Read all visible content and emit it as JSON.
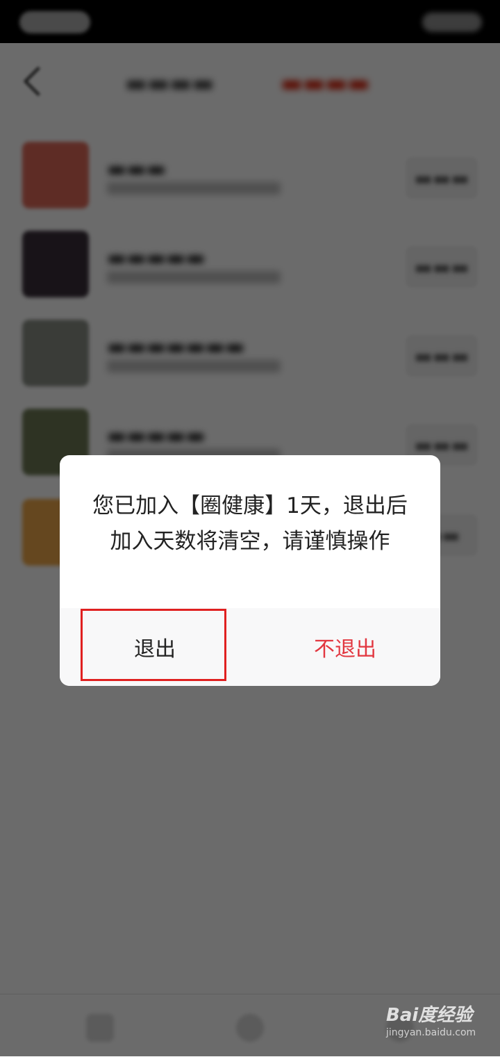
{
  "dialog": {
    "message": "您已加入【圈健康】1天，退出后加入天数将清空，请谨慎操作",
    "exit_label": "退出",
    "stay_label": "不退出"
  },
  "watermark": {
    "logo": "Bai度经验",
    "url": "jingyan.baidu.com"
  },
  "colors": {
    "accent": "#e23740",
    "highlight": "#e02020"
  }
}
